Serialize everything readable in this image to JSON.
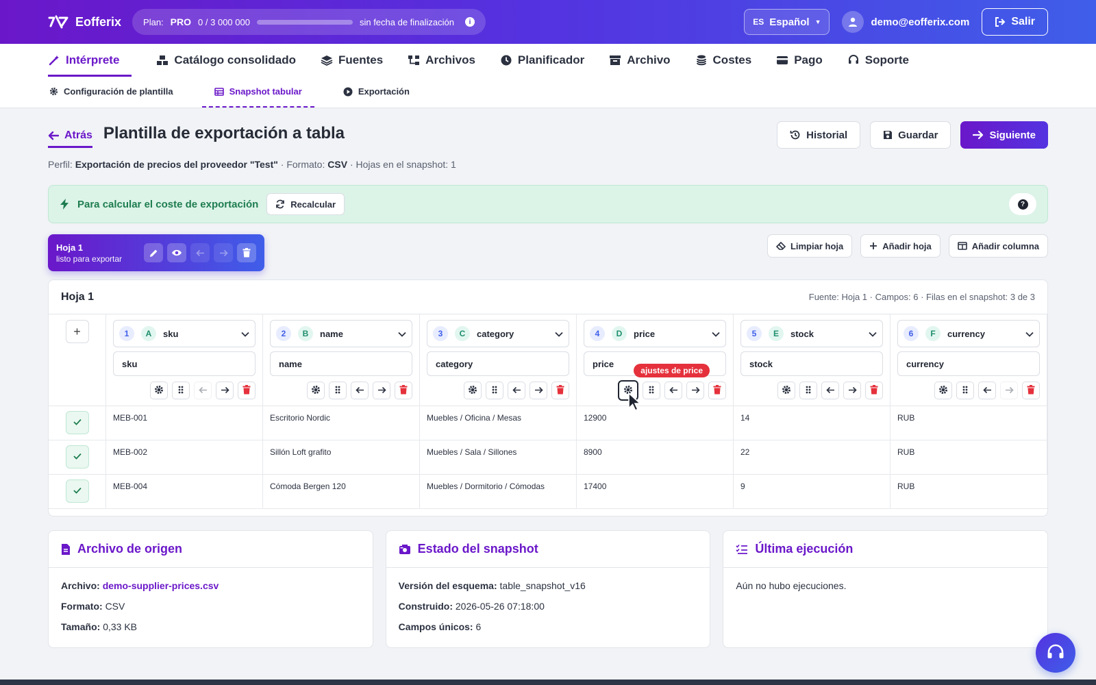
{
  "app": {
    "name": "Eofferix"
  },
  "plan": {
    "label": "Plan:",
    "tier": "PRO",
    "used": "0",
    "sep": "/",
    "total": "3 000 000",
    "usage_fraction": 0,
    "expiry": "sin fecha de finalización"
  },
  "lang": {
    "code": "ES",
    "name": "Español"
  },
  "user": {
    "email": "demo@eofferix.com"
  },
  "logout": {
    "label": "Salir"
  },
  "mainnav": [
    {
      "label": "Intérprete"
    },
    {
      "label": "Catálogo consolidado"
    },
    {
      "label": "Fuentes"
    },
    {
      "label": "Archivos"
    },
    {
      "label": "Planificador"
    },
    {
      "label": "Archivo"
    },
    {
      "label": "Costes"
    },
    {
      "label": "Pago"
    },
    {
      "label": "Soporte"
    }
  ],
  "subnav": [
    {
      "label": "Configuración de plantilla"
    },
    {
      "label": "Snapshot tabular"
    },
    {
      "label": "Exportación"
    }
  ],
  "page": {
    "back": "Atrás",
    "title": "Plantilla de exportación a tabla",
    "history": "Historial",
    "save": "Guardar",
    "next": "Siguiente",
    "profile_label": "Perfil:",
    "profile_name": "Exportación de precios del proveedor \"Test\"",
    "format_label": "· Formato:",
    "format": "CSV",
    "sheets_label": "· Hojas en el snapshot: 1"
  },
  "alert": {
    "text": "Para calcular el coste de exportación",
    "recalc": "Recalcular",
    "help": "?"
  },
  "sheet_tab": {
    "name": "Hoja 1",
    "status": "listo para exportar"
  },
  "sheet_actions": {
    "clear": "Limpiar hoja",
    "add_sheet": "Añadir hoja",
    "add_column": "Añadir columna"
  },
  "table": {
    "title": "Hoja 1",
    "meta": "Fuente: Hoja 1 · Campos: 6 · Filas en el snapshot: 3 de 3",
    "add_button": "+",
    "columns": [
      {
        "num": "1",
        "letter": "A",
        "field": "sku",
        "header": "sku"
      },
      {
        "num": "2",
        "letter": "B",
        "field": "name",
        "header": "name"
      },
      {
        "num": "3",
        "letter": "C",
        "field": "category",
        "header": "category"
      },
      {
        "num": "4",
        "letter": "D",
        "field": "price",
        "header": "price"
      },
      {
        "num": "5",
        "letter": "E",
        "field": "stock",
        "header": "stock"
      },
      {
        "num": "6",
        "letter": "F",
        "field": "currency",
        "header": "currency"
      }
    ],
    "tooltip": "ajustes de price",
    "rows": [
      [
        "MEB-001",
        "Escritorio Nordic",
        "Muebles / Oficina / Mesas",
        "12900",
        "14",
        "RUB"
      ],
      [
        "MEB-002",
        "Sillón Loft grafito",
        "Muebles / Sala / Sillones",
        "8900",
        "22",
        "RUB"
      ],
      [
        "MEB-004",
        "Cómoda Bergen 120",
        "Muebles / Dormitorio / Cómodas",
        "17400",
        "9",
        "RUB"
      ]
    ]
  },
  "cards": {
    "source": {
      "title": "Archivo de origen",
      "file_label": "Archivo:",
      "file": "demo-supplier-prices.csv",
      "format_label": "Formato:",
      "format": "CSV",
      "size_label": "Tamaño:",
      "size": "0,33 KB"
    },
    "snapshot": {
      "title": "Estado del snapshot",
      "schema_label": "Versión del esquema:",
      "schema": "table_snapshot_v16",
      "built_label": "Construido:",
      "built": "2026-05-26 07:18:00",
      "unique_label": "Campos únicos:",
      "unique": "6"
    },
    "last_run": {
      "title": "Última ejecución",
      "text": "Aún no hubo ejecuciones."
    }
  },
  "colors": {
    "accent": "#6a17c9",
    "accent2": "#3f5ee9",
    "success": "#1e7d4f",
    "danger": "#e5313c"
  }
}
